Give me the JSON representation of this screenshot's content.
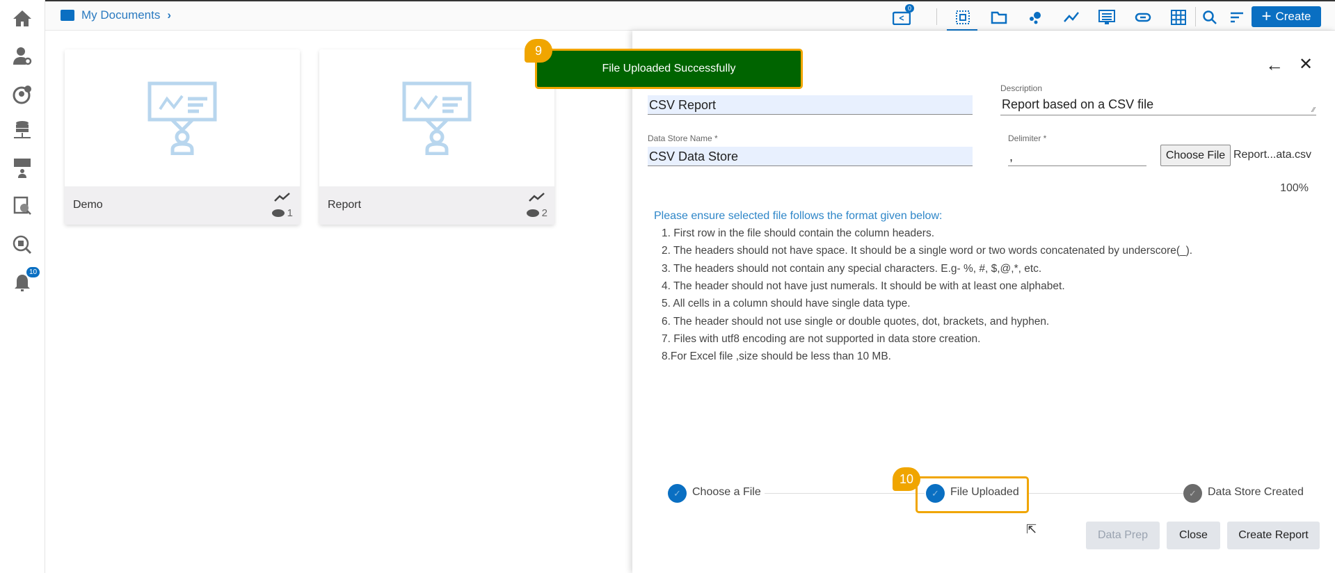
{
  "breadcrumb": {
    "label": "My Documents"
  },
  "topbar": {
    "share_badge": "0",
    "create_label": "Create"
  },
  "sidebar": {
    "notification_badge": "10"
  },
  "cards": [
    {
      "name": "Demo",
      "views": "1"
    },
    {
      "name": "Report",
      "views": "2"
    }
  ],
  "toast": {
    "message": "File Uploaded Successfully",
    "step_badge": "9"
  },
  "panel": {
    "name_value": "CSV Report",
    "description_label": "Description",
    "description_value": "Report based on a CSV file",
    "datastore_label": "Data Store Name *",
    "datastore_value": "CSV Data Store",
    "delimiter_label": "Delimiter *",
    "delimiter_value": ",",
    "choose_file_label": "Choose File",
    "file_name": "Report...ata.csv",
    "progress": "100%",
    "instructions_title": "Please ensure selected file follows the format given below:",
    "instructions": [
      "1. First row in the file should contain the column headers.",
      "2. The headers should not have space. It should be a single word or two words concatenated by underscore(_).",
      "3. The headers should not contain any special characters. E.g- %, #, $,@,*, etc.",
      "4. The header should not have just numerals. It should be with at least one alphabet.",
      "5. All cells in a column should have single data type.",
      "6. The header should not use single or double quotes, dot, brackets, and hyphen.",
      "7. Files with utf8 encoding are not supported in data store creation.",
      "8.For Excel file ,size should be less than 10 MB."
    ],
    "steps": [
      {
        "label": "Choose a File"
      },
      {
        "label": "File Uploaded"
      },
      {
        "label": "Data Store Created"
      }
    ],
    "step_badge": "10",
    "buttons": {
      "data_prep": "Data Prep",
      "close": "Close",
      "create_report": "Create Report"
    }
  },
  "colors": {
    "accent": "#0a6fc2",
    "toast": "#006400",
    "highlight": "#f0a500"
  }
}
